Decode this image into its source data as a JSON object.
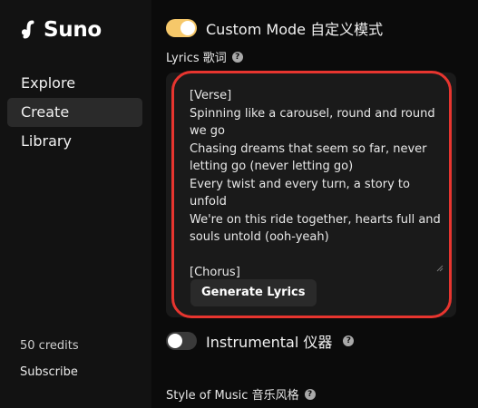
{
  "brand": {
    "name": "Suno"
  },
  "sidebar": {
    "items": [
      {
        "label": "Explore",
        "active": false
      },
      {
        "label": "Create",
        "active": true
      },
      {
        "label": "Library",
        "active": false
      }
    ],
    "credits": "50 credits",
    "subscribe": "Subscribe"
  },
  "form": {
    "custom_mode": {
      "label": "Custom Mode 自定义模式",
      "on": true
    },
    "lyrics_label": "Lyrics 歌词",
    "lyrics_value": "[Verse]\nSpinning like a carousel, round and round we go\nChasing dreams that seem so far, never letting go (never letting go)\nEvery twist and every turn, a story to unfold\nWe're on this ride together, hearts full and souls untold (ooh-yeah)\n\n[Chorus]\nSo let's keep on dancin' in the rhythm of the",
    "generate_lyrics": "Generate Lyrics",
    "instrumental": {
      "label": "Instrumental 仪器",
      "on": false
    },
    "style_label": "Style of Music 音乐风格"
  },
  "colors": {
    "accent_toggle": "#f6c86a",
    "highlight_ring": "#e7352f",
    "sidebar_bg": "#121212",
    "main_bg": "#0b0b0b"
  },
  "icons": {
    "help": "question-circle-icon",
    "logo": "suno-logo-icon"
  }
}
